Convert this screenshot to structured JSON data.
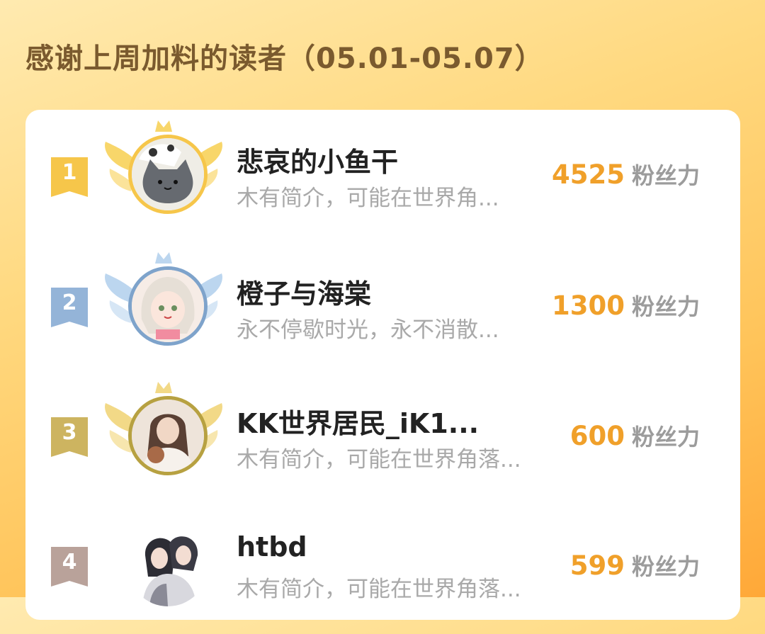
{
  "header": {
    "title": "感谢上周加料的读者（05.01-05.07）"
  },
  "colors": {
    "gold": "#f0a02a",
    "rank1": "#f6c64a",
    "rank2": "#94b4d8",
    "rank3": "#cdb460",
    "rank4": "#b9a29a"
  },
  "rankings": [
    {
      "rank": "1",
      "name": "悲哀的小鱼干",
      "bio": "木有简介，可能在世界角...",
      "score": "4525",
      "unit": "粉丝力",
      "avatar_icon": "gray-cat-avatar"
    },
    {
      "rank": "2",
      "name": "橙子与海棠",
      "bio": "永不停歇时光，永不消散...",
      "score": "1300",
      "unit": "粉丝力",
      "avatar_icon": "anime-girl-avatar"
    },
    {
      "rank": "3",
      "name": "KK世界居民_iK1...",
      "bio": "木有简介，可能在世界角落...",
      "score": "600",
      "unit": "粉丝力",
      "avatar_icon": "girl-photo-avatar"
    },
    {
      "rank": "4",
      "name": "htbd",
      "bio": "木有简介，可能在世界角落...",
      "score": "599",
      "unit": "粉丝力",
      "avatar_icon": "couple-illustration-avatar"
    }
  ]
}
